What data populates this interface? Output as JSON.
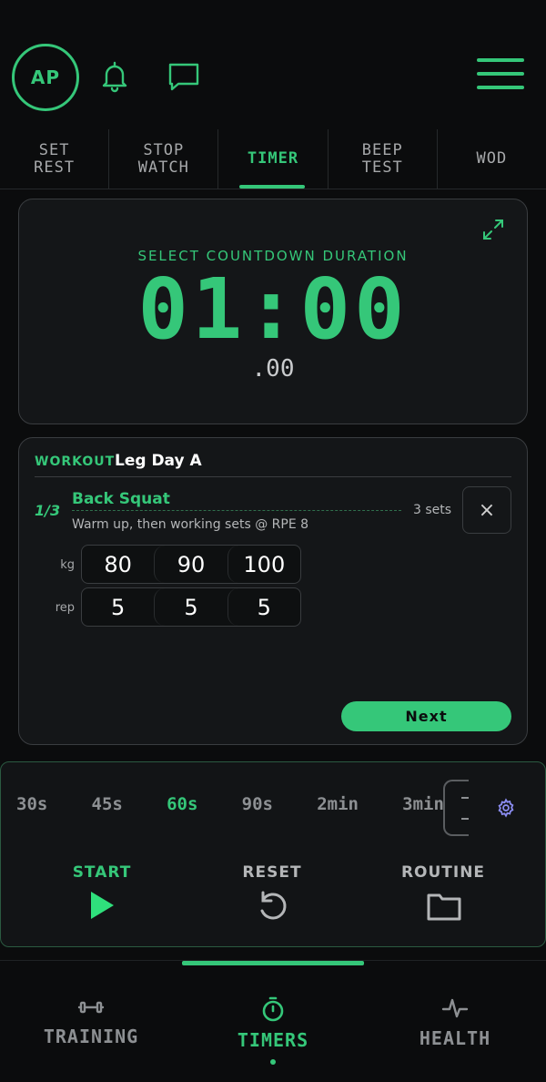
{
  "header": {
    "avatar_initials": "AP",
    "icons": [
      "bell-icon",
      "chat-icon",
      "menu-icon"
    ]
  },
  "tabs": [
    {
      "label": "SET\nREST",
      "active": false
    },
    {
      "label": "STOP\nWATCH",
      "active": false
    },
    {
      "label": "TIMER",
      "active": true
    },
    {
      "label": "BEEP\nTEST",
      "active": false
    },
    {
      "label": "WOD",
      "active": false
    }
  ],
  "timer": {
    "select_label": "SELECT COUNTDOWN DURATION",
    "time": "01:00",
    "fraction": ".00"
  },
  "workout": {
    "label": "WORKOUT",
    "name": "Leg Day A",
    "exercise_index": "1/3",
    "exercise_name": "Back Squat",
    "exercise_sets": "3 sets",
    "exercise_note": "Warm up, then working sets @ RPE 8",
    "close_glyph": "×",
    "kg_label": "kg",
    "rep_label": "rep",
    "kg_values": [
      "80",
      "90",
      "100"
    ],
    "rep_values": [
      "5",
      "5",
      "5"
    ],
    "next_label": "Next"
  },
  "controls": {
    "presets": [
      {
        "label": "30s",
        "active": false
      },
      {
        "label": "45s",
        "active": false
      },
      {
        "label": "60s",
        "active": true
      },
      {
        "label": "90s",
        "active": false
      },
      {
        "label": "2min",
        "active": false
      },
      {
        "label": "3min",
        "active": false
      }
    ],
    "start_label": "START",
    "reset_label": "RESET",
    "routine_label": "ROUTINE"
  },
  "nav": {
    "training_label": "TRAINING",
    "timers_label": "TIMERS",
    "health_label": "HEALTH",
    "active": "TIMERS"
  },
  "colors": {
    "accent": "#35c779",
    "background": "#0b0c0d",
    "card": "#141618"
  }
}
